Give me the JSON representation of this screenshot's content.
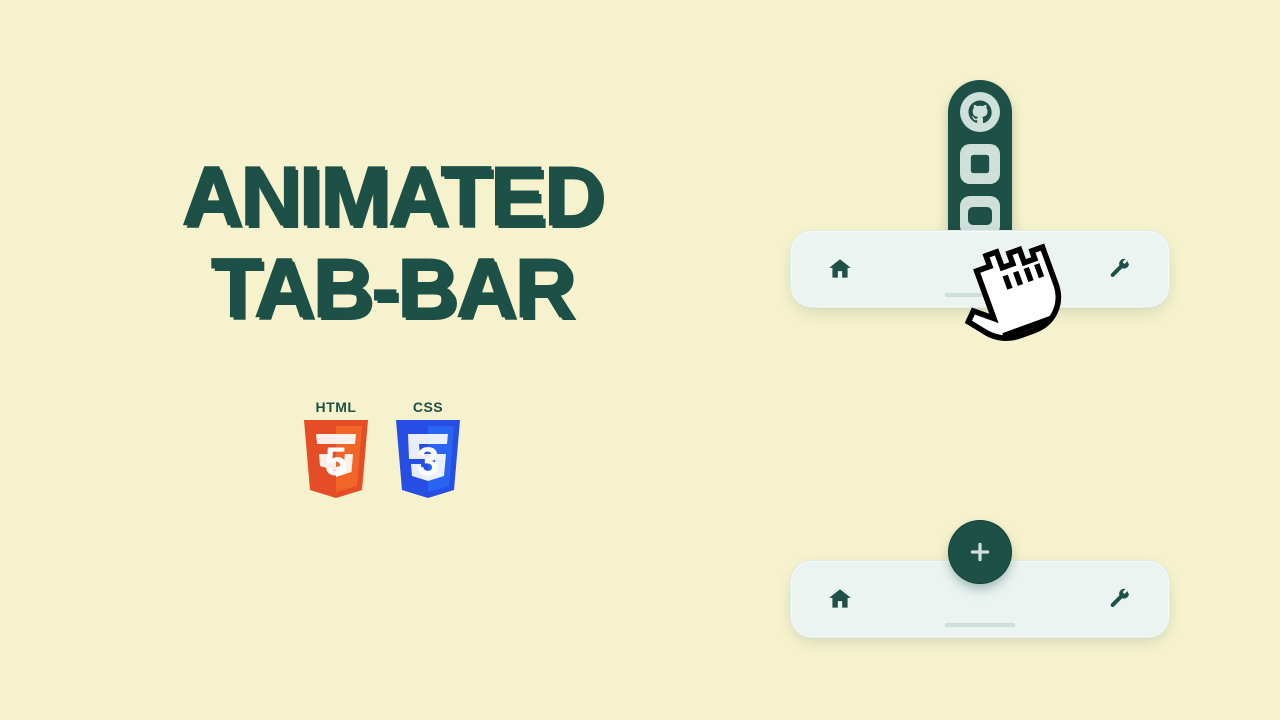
{
  "headline": {
    "line1": "ANIMATED",
    "line2": "TAB-BAR"
  },
  "badges": {
    "html": {
      "label": "HTML",
      "number": "5"
    },
    "css": {
      "label": "CSS",
      "number": "3"
    }
  },
  "icons": {
    "home": "home-icon",
    "wrench": "wrench-icon",
    "plus": "plus-icon",
    "github": "github-icon",
    "linkedin": "linkedin-icon",
    "youtube": "youtube-icon",
    "cursor": "cursor-hand-icon"
  },
  "colors": {
    "background": "#f6f2cd",
    "accent": "#1d5046",
    "bar": "#ebf4f1"
  },
  "tabbars": {
    "expanded": {
      "social_open": true
    },
    "collapsed": {
      "social_open": false
    }
  }
}
